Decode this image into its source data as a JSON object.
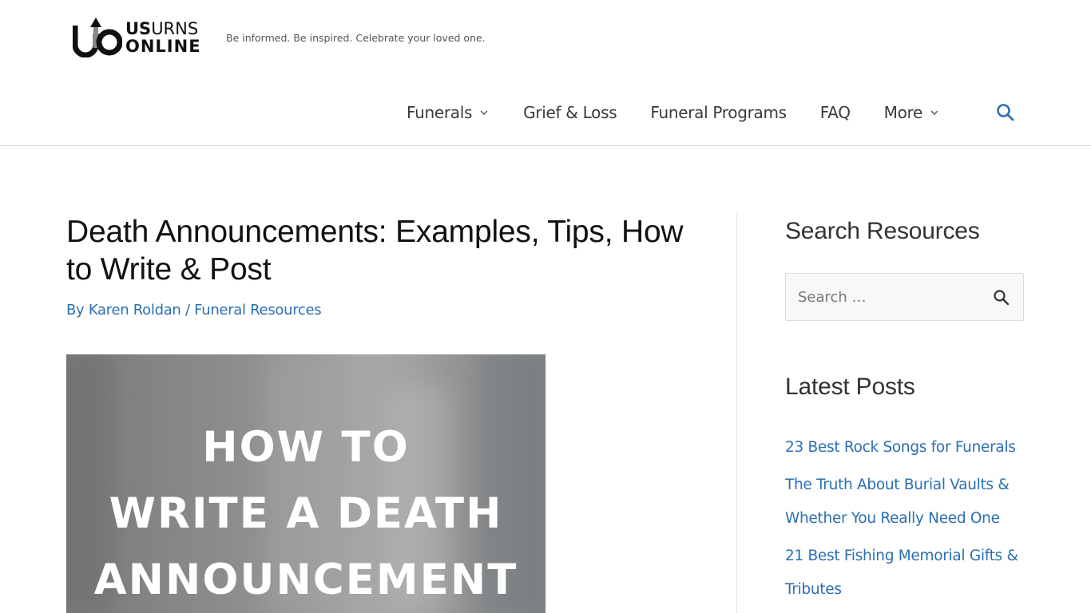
{
  "site": {
    "logo_line1_bold": "US",
    "logo_line1_rest": "URNS",
    "logo_line2": "ONLINE",
    "tagline": "Be informed. Be inspired. Celebrate your loved one."
  },
  "nav": {
    "items": [
      {
        "label": "Funerals",
        "has_dropdown": true
      },
      {
        "label": "Grief & Loss",
        "has_dropdown": false
      },
      {
        "label": "Funeral Programs",
        "has_dropdown": false
      },
      {
        "label": "FAQ",
        "has_dropdown": false
      },
      {
        "label": "More",
        "has_dropdown": true
      }
    ],
    "search_icon": "search-icon"
  },
  "article": {
    "title": "Death Announcements: Examples, Tips, How to Write & Post",
    "meta_by": "By",
    "author": "Karen Roldan",
    "separator": "/",
    "category": "Funeral Resources",
    "featured_image_text": [
      "HOW TO",
      "WRITE A DEATH",
      "ANNOUNCEMENT"
    ]
  },
  "sidebar": {
    "search_widget_title": "Search Resources",
    "search_placeholder": "Search …",
    "search_value": "",
    "latest_posts_title": "Latest Posts",
    "latest_posts": [
      "23 Best Rock Songs for Funerals",
      "The Truth About Burial Vaults & Whether You Really Need One",
      "21 Best Fishing Memorial Gifts & Tributes"
    ]
  },
  "colors": {
    "link": "#2b6fb3",
    "text": "#3a3a3a",
    "heading": "#111111",
    "border": "#dddddd"
  }
}
